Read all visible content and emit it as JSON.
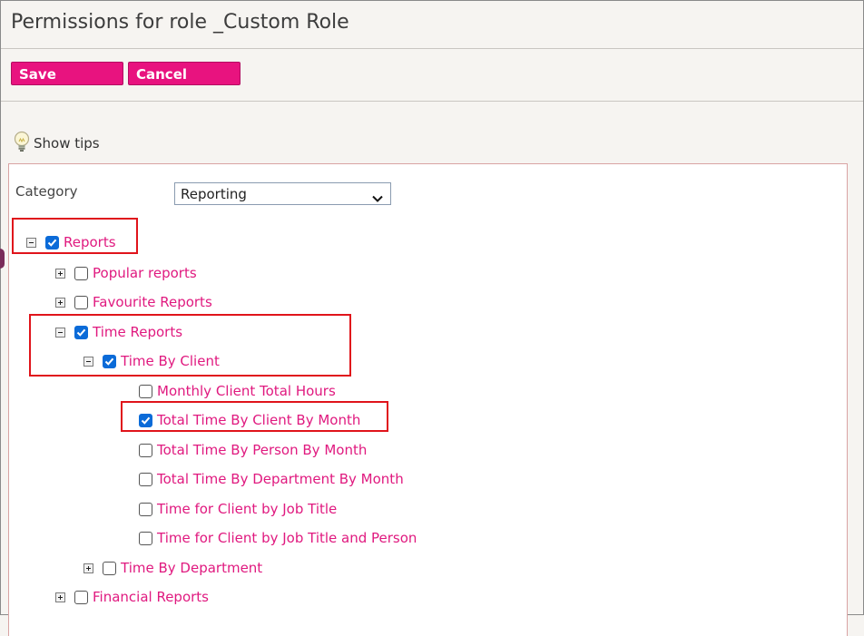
{
  "header": {
    "title": "Permissions for role _Custom Role"
  },
  "toolbar": {
    "save_label": "Save",
    "cancel_label": "Cancel"
  },
  "tips": {
    "label": "Show tips",
    "icon": "lightbulb-icon"
  },
  "filter": {
    "category_label": "Category",
    "category_value": "Reporting"
  },
  "tree": {
    "reports": {
      "label": "Reports",
      "checked": true,
      "expanded": true
    },
    "popular_reports": {
      "label": "Popular reports",
      "checked": false,
      "expanded": false
    },
    "favourite_reports": {
      "label": "Favourite Reports",
      "checked": false,
      "expanded": false
    },
    "time_reports": {
      "label": "Time Reports",
      "checked": true,
      "expanded": true
    },
    "time_by_client": {
      "label": "Time By Client",
      "checked": true,
      "expanded": true
    },
    "monthly_client_total_hours": {
      "label": "Monthly Client Total Hours",
      "checked": false
    },
    "total_time_by_client_by_month": {
      "label": "Total Time By Client By Month",
      "checked": true
    },
    "total_time_by_person_by_month": {
      "label": "Total Time By Person By Month",
      "checked": false
    },
    "total_time_by_department_by_month": {
      "label": "Total Time By Department By Month",
      "checked": false
    },
    "time_for_client_by_job_title": {
      "label": "Time for Client by Job Title",
      "checked": false
    },
    "time_for_client_by_job_title_and_person": {
      "label": "Time for Client by Job Title and Person",
      "checked": false
    },
    "time_by_department": {
      "label": "Time By Department",
      "checked": false,
      "expanded": false
    },
    "financial_reports": {
      "label": "Financial Reports",
      "checked": false,
      "expanded": false
    }
  },
  "colors": {
    "accent": "#e8137f",
    "link": "#e0197f",
    "highlight": "#e0141b",
    "checkbox": "#0b6bd8"
  }
}
